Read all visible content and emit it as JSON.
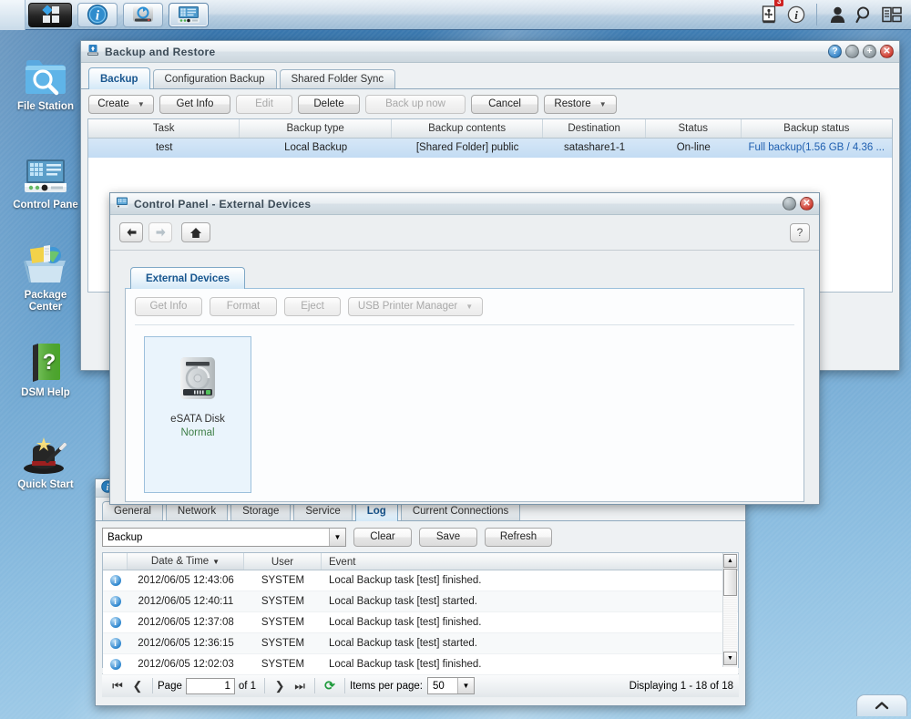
{
  "taskbar": {
    "main_menu_icon": "app-grid-icon",
    "apps": [
      {
        "name": "info-center-icon",
        "title": "Information"
      },
      {
        "name": "storage-manager-icon",
        "title": "Storage Manager"
      },
      {
        "name": "control-panel-icon",
        "title": "Control Panel"
      }
    ],
    "tray": {
      "usb_icon": "usb-device-icon",
      "notification_icon": "notification-info-icon",
      "notification_count": "3",
      "user_icon": "user-icon",
      "search_icon": "search-icon",
      "widgets_icon": "widgets-icon"
    }
  },
  "desktop": {
    "icons": [
      {
        "label": "File Station",
        "name": "file-station",
        "icon": "folder-search-icon"
      },
      {
        "label": "Control Pane",
        "name": "control-panel",
        "icon": "control-panel-icon"
      },
      {
        "label": "Package\nCenter",
        "line1": "Package",
        "line2": "Center",
        "name": "package-center",
        "icon": "package-box-icon"
      },
      {
        "label": "DSM Help",
        "name": "dsm-help",
        "icon": "help-book-icon"
      },
      {
        "label": "Quick Start",
        "name": "quick-start",
        "icon": "magic-hat-icon"
      }
    ],
    "show_desktop_icon": "chevron-up-icon"
  },
  "backup_window": {
    "title": "Backup and Restore",
    "title_icon": "backup-restore-icon",
    "controls": {
      "help": "?",
      "minimize": "—",
      "maximize": "+",
      "close": "✕"
    },
    "tabs": [
      {
        "label": "Backup",
        "active": true
      },
      {
        "label": "Configuration Backup",
        "active": false
      },
      {
        "label": "Shared Folder Sync",
        "active": false
      }
    ],
    "toolbar": [
      {
        "label": "Create",
        "disabled": false,
        "caret": true
      },
      {
        "label": "Get Info",
        "disabled": false,
        "caret": false
      },
      {
        "label": "Edit",
        "disabled": true,
        "caret": false
      },
      {
        "label": "Delete",
        "disabled": false,
        "caret": false
      },
      {
        "label": "Back up now",
        "disabled": true,
        "caret": false
      },
      {
        "label": "Cancel",
        "disabled": false,
        "caret": false
      },
      {
        "label": "Restore",
        "disabled": false,
        "caret": true
      }
    ],
    "columns": [
      "Task",
      "Backup type",
      "Backup contents",
      "Destination",
      "Status",
      "Backup status"
    ],
    "rows": [
      {
        "task": "test",
        "backup_type": "Local Backup",
        "backup_contents": "[Shared Folder] public",
        "destination": "satashare1-1",
        "status": "On-line",
        "backup_status": "Full backup(1.56 GB / 4.36 ...",
        "selected": true
      }
    ]
  },
  "control_panel_dialog": {
    "title": "Control Panel - External Devices",
    "title_icon": "control-panel-icon",
    "controls": {
      "minimize": "—",
      "close": "✕"
    },
    "nav": {
      "back_icon": "arrow-left-icon",
      "forward_icon": "arrow-right-icon",
      "home_icon": "home-icon",
      "help_label": "?"
    },
    "tabs": [
      {
        "label": "External Devices",
        "active": true
      }
    ],
    "toolbar": [
      {
        "label": "Get Info",
        "disabled": true,
        "caret": false
      },
      {
        "label": "Format",
        "disabled": true,
        "caret": false
      },
      {
        "label": "Eject",
        "disabled": true,
        "caret": false
      },
      {
        "label": "USB Printer Manager",
        "disabled": true,
        "caret": true
      }
    ],
    "devices": [
      {
        "name": "eSATA Disk",
        "state": "Normal",
        "icon": "external-hard-disk-icon"
      }
    ]
  },
  "info_window": {
    "title_icon": "info-center-icon",
    "tabs": [
      {
        "label": "General",
        "active": false
      },
      {
        "label": "Network",
        "active": false
      },
      {
        "label": "Storage",
        "active": false
      },
      {
        "label": "Service",
        "active": false
      },
      {
        "label": "Log",
        "active": true
      },
      {
        "label": "Current Connections",
        "active": false
      }
    ],
    "filter": {
      "value": "Backup",
      "dropdown_icon": "chevron-down-icon"
    },
    "actions": [
      {
        "label": "Clear"
      },
      {
        "label": "Save"
      },
      {
        "label": "Refresh"
      }
    ],
    "columns": [
      "",
      "Date & Time",
      "User",
      "Event"
    ],
    "sort_indicator": "▾",
    "rows": [
      {
        "icon": "info-icon",
        "datetime": "2012/06/05 12:43:06",
        "user": "SYSTEM",
        "event": "Local Backup task [test] finished."
      },
      {
        "icon": "info-icon",
        "datetime": "2012/06/05 12:40:11",
        "user": "SYSTEM",
        "event": "Local Backup task [test] started."
      },
      {
        "icon": "info-icon",
        "datetime": "2012/06/05 12:37:08",
        "user": "SYSTEM",
        "event": "Local Backup task [test] finished."
      },
      {
        "icon": "info-icon",
        "datetime": "2012/06/05 12:36:15",
        "user": "SYSTEM",
        "event": "Local Backup task [test] started."
      },
      {
        "icon": "info-icon",
        "datetime": "2012/06/05 12:02:03",
        "user": "SYSTEM",
        "event": "Local Backup task [test] finished."
      }
    ],
    "pager": {
      "first_icon": "first-page-icon",
      "prev_icon": "prev-page-icon",
      "next_icon": "next-page-icon",
      "last_icon": "last-page-icon",
      "refresh_icon": "refresh-icon",
      "page_label": "Page",
      "page_value": "1",
      "of_label": "of 1",
      "items_label": "Items per page:",
      "items_value": "50",
      "items_dropdown_icon": "chevron-down-icon",
      "displaying": "Displaying 1 - 18 of 18"
    }
  }
}
